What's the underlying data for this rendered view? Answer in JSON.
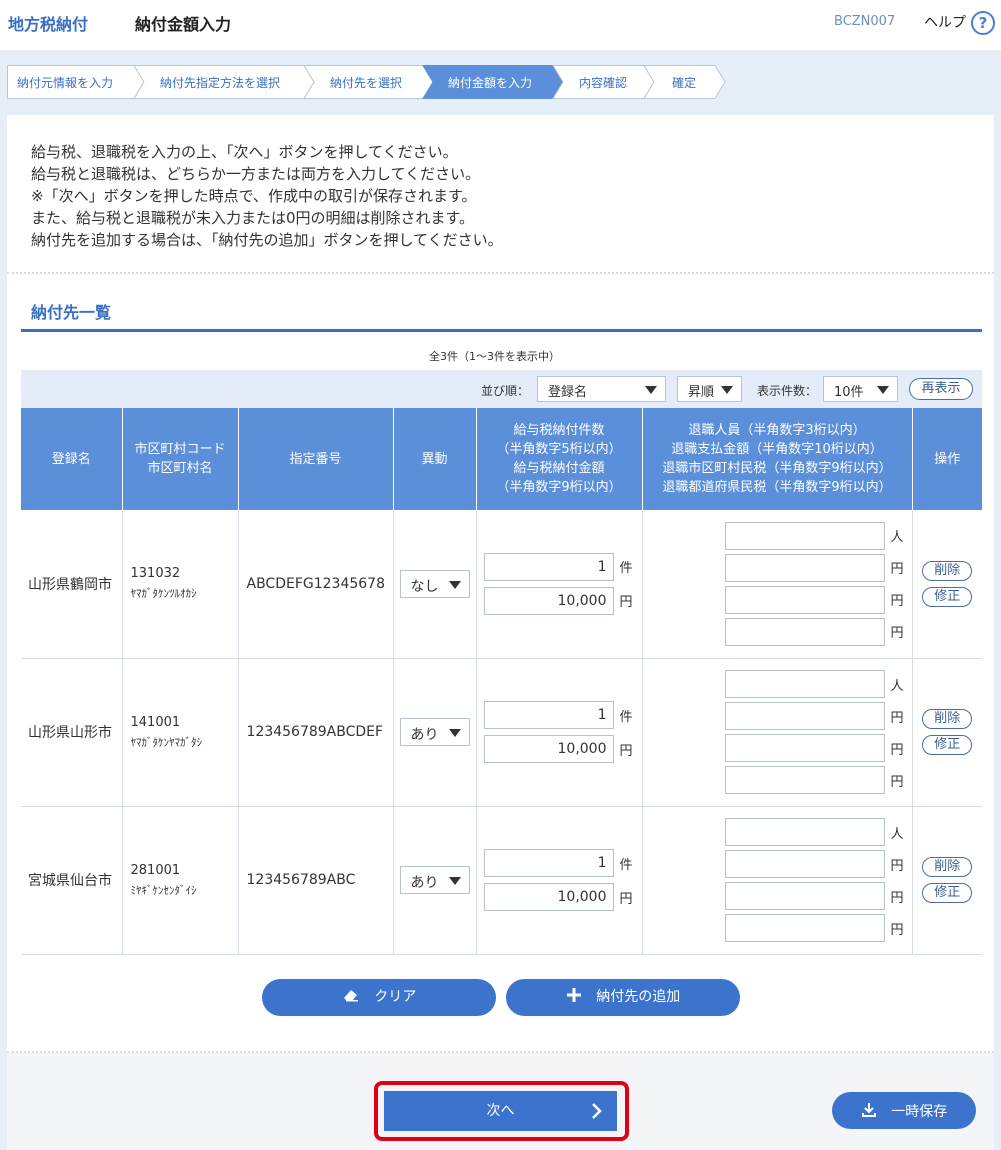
{
  "header": {
    "app_title": "地方税納付",
    "page_title": "納付金額入力",
    "screen_id": "BCZN007",
    "help_label": "ヘルプ",
    "help_icon": "?"
  },
  "steps": [
    {
      "label": "納付元情報を入力",
      "active": false
    },
    {
      "label": "納付先指定方法を選択",
      "active": false
    },
    {
      "label": "納付先を選択",
      "active": false
    },
    {
      "label": "納付金額を入力",
      "active": true
    },
    {
      "label": "内容確認",
      "active": false
    },
    {
      "label": "確定",
      "active": false
    }
  ],
  "intro": [
    "給与税、退職税を入力の上、「次へ」ボタンを押してください。",
    "給与税と退職税は、どちらか一方または両方を入力してください。",
    "※「次へ」ボタンを押した時点で、作成中の取引が保存されます。",
    "また、給与税と退職税が未入力または0円の明細は削除されます。",
    "納付先を追加する場合は、「納付先の追加」ボタンを押してください。"
  ],
  "section_title": "納付先一覧",
  "count_text": "全3件（1～3件を表示中）",
  "controls": {
    "sort_label": "並び順：",
    "sort_value": "登録名",
    "order_value": "昇順",
    "per_page_label": "表示件数：",
    "per_page_value": "10件",
    "redisplay_label": "再表示"
  },
  "columns": {
    "name": "登録名",
    "code_1": "市区町村コード",
    "code_2": "市区町村名",
    "number": "指定番号",
    "move": "異動",
    "salary_1": "給与税納付件数",
    "salary_2": "（半角数字5桁以内）",
    "salary_3": "給与税納付金額",
    "salary_4": "（半角数字9桁以内）",
    "retire_1": "退職人員（半角数字3桁以内）",
    "retire_2": "退職支払金額（半角数字10桁以内）",
    "retire_3": "退職市区町村民税（半角数字9桁以内）",
    "retire_4": "退職都道府県民税（半角数字9桁以内）",
    "ops": "操作"
  },
  "units": {
    "count": "件",
    "yen": "円",
    "person": "人"
  },
  "row_buttons": {
    "delete": "削除",
    "edit": "修正"
  },
  "rows": [
    {
      "name": "山形県鶴岡市",
      "code": "131032",
      "kana": "ﾔﾏｶﾞﾀｹﾝﾂﾙｵｶｼ",
      "number": "ABCDEFG12345678",
      "move": "なし",
      "count": "1",
      "amount": "10,000"
    },
    {
      "name": "山形県山形市",
      "code": "141001",
      "kana": "ﾔﾏｶﾞﾀｹﾝﾔﾏｶﾞﾀｼ",
      "number": "123456789ABCDEF",
      "move": "あり",
      "count": "1",
      "amount": "10,000"
    },
    {
      "name": "宮城県仙台市",
      "code": "281001",
      "kana": "ﾐﾔｷﾞｹﾝｾﾝﾀﾞｲｼ",
      "number": "123456789ABC",
      "move": "あり",
      "count": "1",
      "amount": "10,000"
    }
  ],
  "actions": {
    "clear_label": "クリア",
    "add_label": "納付先の追加",
    "next_label": "次へ",
    "save_label": "一時保存"
  },
  "colors": {
    "primary": "#3c74cd",
    "header_bg": "#5b8fd9",
    "highlight": "#e00010"
  }
}
